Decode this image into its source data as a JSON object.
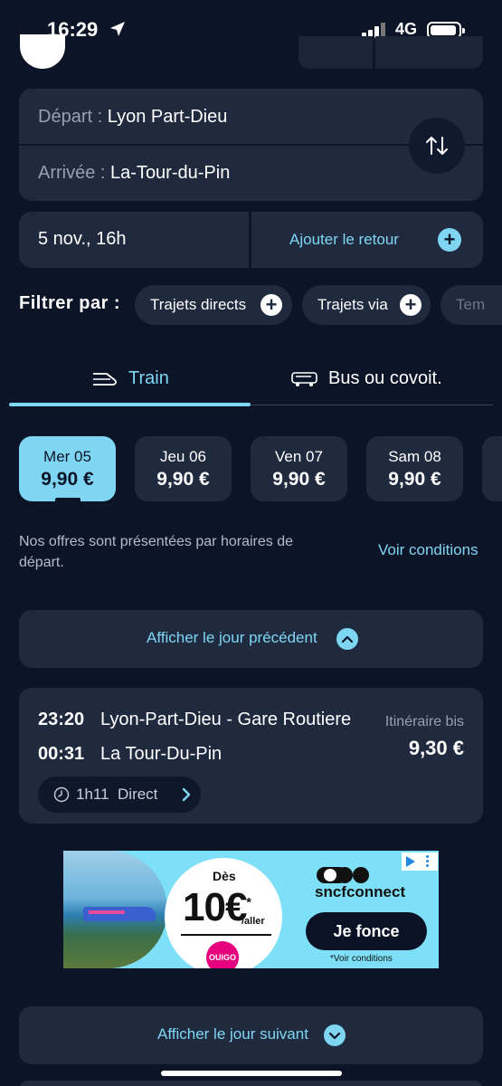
{
  "status_bar": {
    "time": "16:29",
    "network": "4G"
  },
  "route": {
    "departure_label": "Départ :",
    "departure_value": "Lyon Part-Dieu",
    "arrival_label": "Arrivée :",
    "arrival_value": "La-Tour-du-Pin"
  },
  "date": {
    "value": "5 nov., 16h",
    "return_label": "Ajouter le retour"
  },
  "filters": {
    "label": "Filtrer par :",
    "chips": [
      {
        "label": "Trajets directs"
      },
      {
        "label": "Trajets via"
      },
      {
        "label": "Tem"
      }
    ]
  },
  "tabs": [
    {
      "label": "Train",
      "icon": "train-icon",
      "active": true
    },
    {
      "label": "Bus ou covoit.",
      "icon": "bus-icon",
      "active": false
    }
  ],
  "days": [
    {
      "name": "Mer 05",
      "price": "9,90 €",
      "selected": true
    },
    {
      "name": "Jeu 06",
      "price": "9,90 €",
      "selected": false
    },
    {
      "name": "Ven 07",
      "price": "9,90 €",
      "selected": false
    },
    {
      "name": "Sam 08",
      "price": "9,90 €",
      "selected": false
    }
  ],
  "info": {
    "text": "Nos offres sont présentées par horaires de départ.",
    "conditions_link": "Voir conditions"
  },
  "prev_day_label": "Afficher le jour précédent",
  "trip": {
    "departure_time": "23:20",
    "departure_station": "Lyon-Part-Dieu - Gare Routiere",
    "arrival_time": "00:31",
    "arrival_station": "La Tour-Du-Pin",
    "note": "Itinéraire bis",
    "price": "9,30 €",
    "duration": "1h11",
    "type": "Direct"
  },
  "ad": {
    "prefix": "Dès",
    "amount": "10€",
    "asterisk": "*",
    "per": "/aller",
    "ouigo": "OUIGO",
    "brand": "sncfconnect",
    "cta": "Je fonce",
    "fine_print": "*Voir conditions"
  },
  "next_day_label": "Afficher le jour suivant",
  "colors": {
    "background": "#0c1427",
    "card": "#202a3e",
    "accent": "#7fd6f3"
  }
}
